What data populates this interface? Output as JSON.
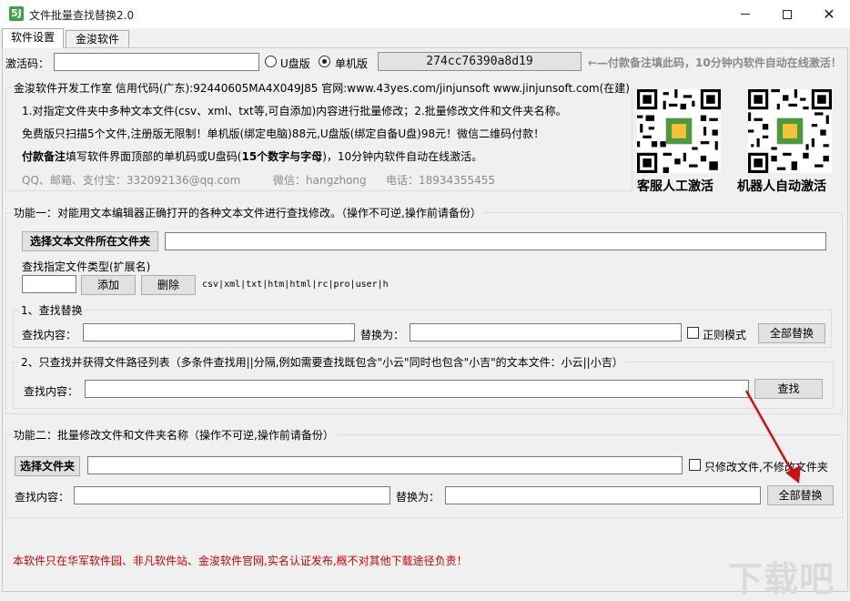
{
  "window": {
    "icon_text": "5J",
    "title": "文件批量查找替换2.0"
  },
  "tabs": [
    {
      "label": "软件设置",
      "active": true
    },
    {
      "label": "金浚软件",
      "active": false
    }
  ],
  "activation": {
    "label": "激活码：",
    "value": "",
    "usb_label": "U盘版",
    "usb_selected": false,
    "standalone_label": "单机版",
    "standalone_selected": true,
    "machine_code": "274cc76390a8d19",
    "hint": "←—付款备注填此码，10分钟内软件自动在线激活！"
  },
  "info": {
    "legend": "金浚软件开发工作室 信用代码(广东):92440605MA4X049J85 官网:www.43yes.com/jinjunsoft  www.jinjunsoft.com(在建)",
    "line1": "1.对指定文件夹中多种文本文件(csv、xml、txt等,可自添加)内容进行批量修改；2.批量修改文件和文件夹名称。",
    "line2": "免费版只扫描5个文件,注册版无限制！单机版(绑定电脑)88元,U盘版(绑定自备U盘)98元！微信二维码付款！",
    "line3_bold": "付款备注",
    "line3_rest1": "填写软件界面顶部的单机码或U盘码(",
    "line3_bold2": "15个数字与字母",
    "line3_rest2": ")，10分钟内软件自动在线激活。",
    "contact_qq": "QQ、邮箱、支付宝：332092136@qq.com",
    "contact_wechat": "微信：hangzhong",
    "contact_phone": "电话：18934355455"
  },
  "qr_codes": [
    {
      "label": "客服人工激活"
    },
    {
      "label": "机器人自动激活"
    }
  ],
  "func1": {
    "legend": "功能一：对能用文本编辑器正确打开的各种文本文件进行查找修改。（操作不可逆,操作前请备份）",
    "select_folder_button": "选择文本文件所在文件夹",
    "folder_path": "",
    "ext_label": "查找指定文件类型(扩展名)",
    "ext_value": "",
    "add_button": "添加",
    "delete_button": "删除",
    "ext_list": "csv|xml|txt|htm|html|rc|pro|user|h",
    "sub1": {
      "legend": "1、查找替换",
      "find_label": "查找内容：",
      "find_value": "",
      "replace_label": "替换为：",
      "replace_value": "",
      "regex_label": "正则模式",
      "regex_checked": false,
      "replace_all_button": "全部替换"
    },
    "sub2": {
      "legend": "2、只查找并获得文件路径列表（多条件查找用||分隔,例如需要查找既包含\"小云\"同时也包含\"小吉\"的文本文件：小云||小吉）",
      "find_label": "查找内容：",
      "find_value": "",
      "find_button": "查找"
    }
  },
  "func2": {
    "legend": "功能二：批量修改文件和文件夹名称（操作不可逆,操作前请备份）",
    "select_folder_button": "选择文件夹",
    "folder_path": "",
    "only_files_label": "只修改文件,不修改文件夹",
    "only_files_checked": false,
    "find_label": "查找内容：",
    "find_value": "",
    "replace_label": "替换为：",
    "replace_value": "",
    "replace_all_button": "全部替换"
  },
  "footer": {
    "notice": "本软件只在华军软件园、非凡软件站、金浚软件官网,实名认证发布,概不对其他下载途径负责！",
    "watermark": "下载吧"
  },
  "colors": {
    "notice_red": "#d40000",
    "arrow_red": "#d01010",
    "hint_gray": "#8a8a8a"
  }
}
